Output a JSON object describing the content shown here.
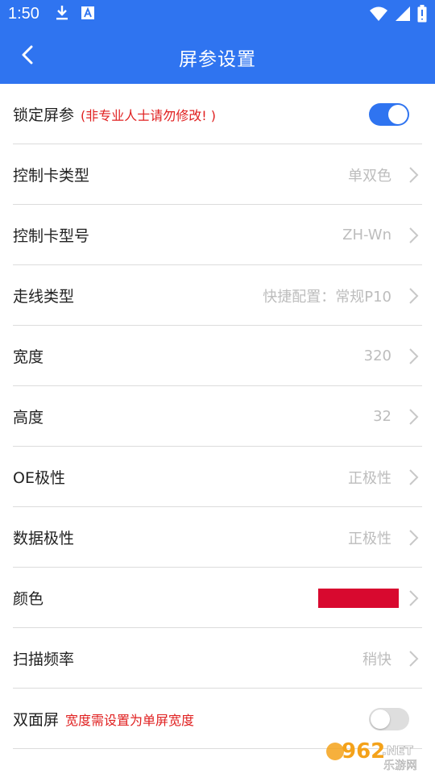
{
  "status_bar": {
    "time": "1:50",
    "icons_left": [
      "download-icon",
      "text-a-icon"
    ],
    "icons_right": [
      "wifi-icon",
      "signal-icon",
      "battery-icon"
    ]
  },
  "header": {
    "title": "屏参设置",
    "back_icon": "chevron-left-icon"
  },
  "colors": {
    "primary": "#2f74f0",
    "note_red": "#e02020",
    "value_gray": "#bdbdbd",
    "color_swatch": "#d8092f",
    "toggle_off": "#dedede"
  },
  "settings": {
    "lock": {
      "label": "锁定屏参",
      "note": "(非专业人士请勿修改! )",
      "toggle_on": true
    },
    "card_type": {
      "label": "控制卡类型",
      "value": "单双色"
    },
    "card_model": {
      "label": "控制卡型号",
      "value": "ZH-Wn"
    },
    "scan_type": {
      "label": "走线类型",
      "value": "快捷配置：常规P10"
    },
    "width": {
      "label": "宽度",
      "value": "320"
    },
    "height": {
      "label": "高度",
      "value": "32"
    },
    "oe_polarity": {
      "label": "OE极性",
      "value": "正极性"
    },
    "data_polarity": {
      "label": "数据极性",
      "value": "正极性"
    },
    "color": {
      "label": "颜色"
    },
    "scan_rate": {
      "label": "扫描频率",
      "value": "稍快"
    },
    "double_sided": {
      "label": "双面屏",
      "note": "宽度需设置为单屏宽度",
      "toggle_on": false
    }
  },
  "watermark": {
    "brand": "962",
    "suffix": ".NET",
    "caption": "乐游网"
  }
}
